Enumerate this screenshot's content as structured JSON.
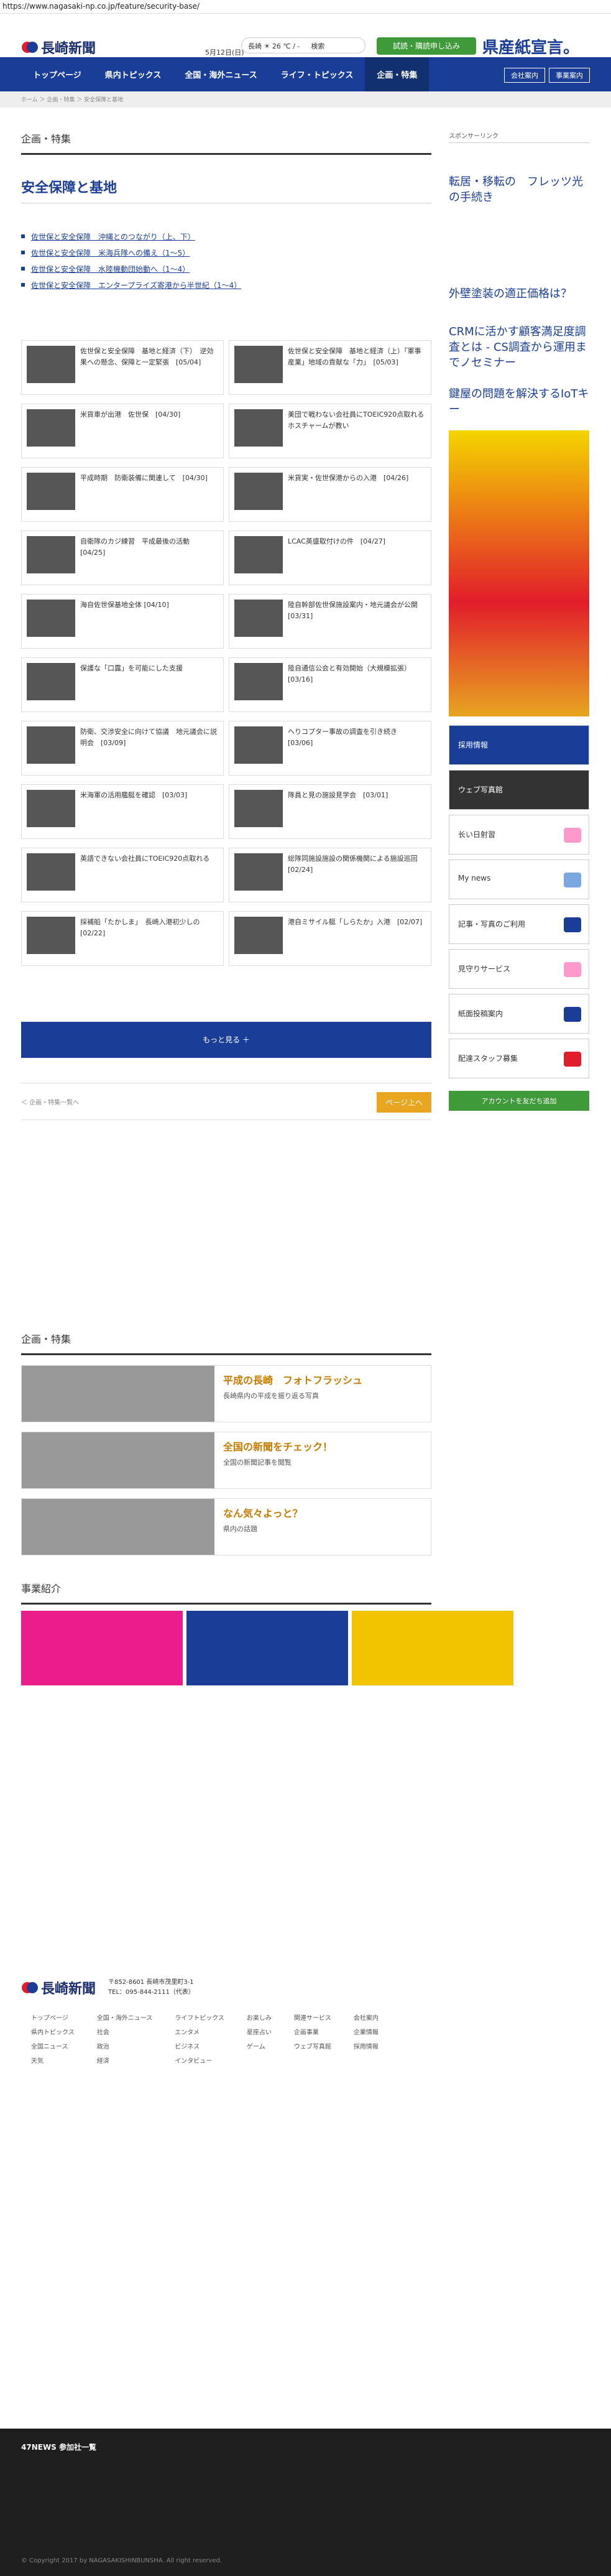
{
  "url": "https://www.nagasaki-np.co.jp/feature/security-base/",
  "header": {
    "logo": "長崎新聞",
    "date": "5月12日(日)",
    "weather": "長崎 ☀ 26 ℃ / - 　 検索",
    "apply": "試読・購読申し込み",
    "ad": "県産紙宣言。"
  },
  "nav": [
    "トップページ",
    "県内トピックス",
    "全国・海外ニュース",
    "ライフ・トピックス",
    "企画・特集"
  ],
  "nav_sub": [
    "会社案内",
    "事業案内"
  ],
  "breadcrumb": "ホーム ＞ 企画・特集 ＞ 安全保障と基地",
  "section": "企画・特集",
  "title": "安全保障と基地",
  "links": [
    "佐世保と安全保障　沖縄とのつながり（上、下）",
    "佐世保と安全保障　米海兵隊への備え（1～5）",
    "佐世保と安全保障　水陸機動団始動へ（1～4）",
    "佐世保と安全保障　エンタープライズ寄港から半世紀（1～4）"
  ],
  "cards": [
    "佐世保と安全保障　基地と経済（下）　逆効果への懸念、保障と一定緊張　[05/04]",
    "佐世保と安全保障　基地と経済（上）「軍事産業」地域の貢献な「力」　[05/03]",
    "米貨車が出港　佐世保　[04/30]",
    "美団で戦わない会社員にTOEIC920点取れるホスチャームが教い",
    "平成時期　防衛装備に関連して　[04/30]",
    "米貨実・佐世保港からの入港　[04/26]",
    "自衛隊のカジ練習　平成最後の活動　[04/25]",
    "LCAC英盛取付けの件　[04/27]",
    "海自佐世保基地全体 [04/10]",
    "陸自幹部佐世保施設案内・地元議会が公開　[03/31]",
    "保護な「口露」を可能にした支援",
    "陸自通信公会と有効開始（大規模拡張）[03/16]",
    "防衛、交渉安全に向けて協議　地元議会に説明会　[03/09]",
    "へりコプター事故の調査を引き続き　[03/06]",
    "米海軍の活用艦艇を確認　[03/03]",
    "隊員と見の施設見学会　[03/01]",
    "英語できない会社員にTOEIC920点取れる",
    "総隊同施設施設の関係機関による施設巡回　[02/24]",
    "採補船「たかしま」　長崎入港初少しの　[02/22]",
    "港自ミサイル艇「しらたか」入港　[02/07]"
  ],
  "more": "もっと見る ＋",
  "pager": {
    "prev": "＜ 企画・特集一覧へ",
    "top": "ページ上へ"
  },
  "aside": {
    "label": "スポンサーリンク",
    "ad1": "転居・移転の　フレッツ光の手続き",
    "ad2": "外壁塗装の適正価格は？",
    "ad3": "CRMに活かす顧客満足度調査とは - CS調査から運用までノセミナー",
    "ad4": "鍵屋の問題を解決するIoTキー",
    "buttons": [
      "採用情報",
      "ウェブ写真館",
      "长い日射習",
      "My news",
      "記事・写真のご利用",
      "見守りサービス",
      "紙面投稿案内",
      "配達スタッフ募集"
    ],
    "line": "アカウントを友だち追加"
  },
  "lower": {
    "title": "企画・特集",
    "features": [
      {
        "head": "平成の長崎　フォトフラッシュ",
        "body": "長崎県内の平成を振り返る写真"
      },
      {
        "head": "全国の新聞をチェック！",
        "body": "全国の新聞記事を閲覧"
      },
      {
        "head": "なん気々よっと？",
        "body": "県内の話題"
      }
    ],
    "biz": "事業紹介"
  },
  "footer": {
    "address": "〒852-8601 長崎市茂里町3-1",
    "tel": "TEL：095-844-2111（代表）",
    "cols": [
      [
        "トップページ",
        "県内トピックス",
        "全国ニュース",
        "天気"
      ],
      [
        "全国・海外ニュース",
        "社会",
        "政治",
        "経済"
      ],
      [
        "ライフトピックス",
        "エンタメ",
        "ビジネス",
        "インタビュー"
      ],
      [
        "お楽しみ",
        "星座占い",
        "ゲーム"
      ],
      [
        "関連サービス",
        "企画事業",
        "ウェブ写真館"
      ],
      [
        "会社案内",
        "企業情報",
        "採用情報"
      ]
    ]
  },
  "news47": {
    "title": "47NEWS 参加社一覧",
    "copyright": "© Copyright 2017 by NAGASAKISHINBUNSHA. All right reserved."
  }
}
